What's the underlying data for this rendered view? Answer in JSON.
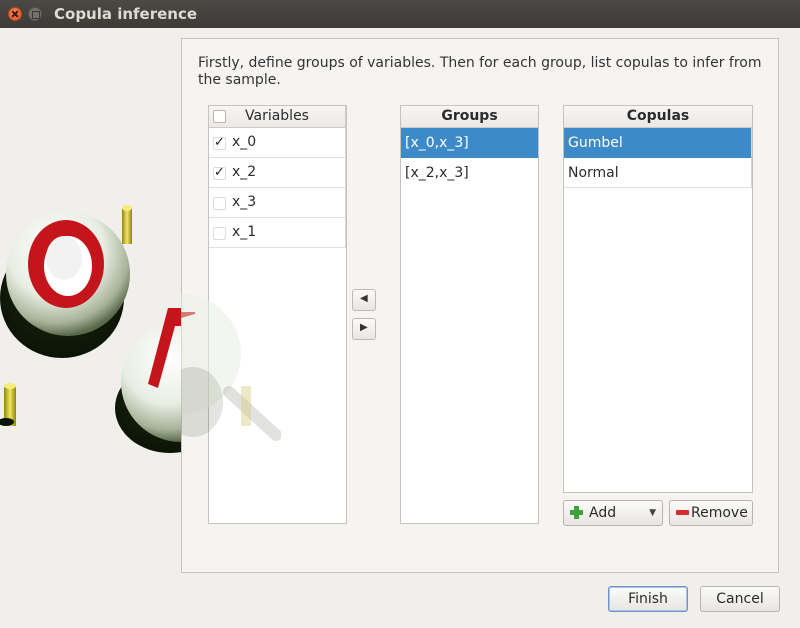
{
  "window": {
    "title": "Copula inference"
  },
  "intro_text": "Firstly, define groups of variables. Then for each group, list copulas to infer from the sample.",
  "variables": {
    "header": "Variables",
    "items": [
      {
        "label": "x_0",
        "checked": true
      },
      {
        "label": "x_2",
        "checked": true
      },
      {
        "label": "x_3",
        "checked": false
      },
      {
        "label": "x_1",
        "checked": false
      }
    ]
  },
  "groups": {
    "header": "Groups",
    "items": [
      {
        "label": "[x_0,x_3]",
        "selected": true
      },
      {
        "label": "[x_2,x_3]",
        "selected": false
      }
    ]
  },
  "copulas": {
    "header": "Copulas",
    "items": [
      {
        "label": "Gumbel",
        "selected": true
      },
      {
        "label": "Normal",
        "selected": false
      }
    ],
    "add_label": "Add",
    "remove_label": "Remove"
  },
  "buttons": {
    "finish": "Finish",
    "cancel": "Cancel"
  },
  "colors": {
    "selection": "#3d8ac8",
    "titlebar": "#3c3b37",
    "close": "#e0531f"
  }
}
